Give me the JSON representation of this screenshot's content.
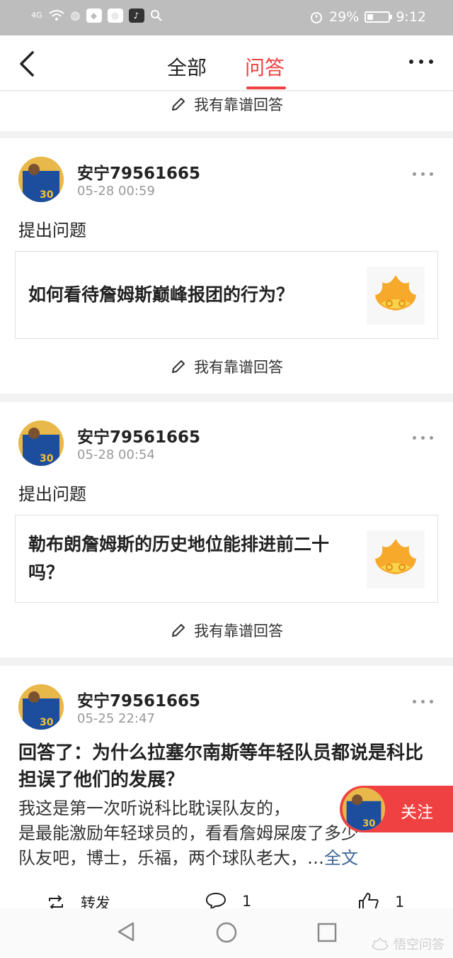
{
  "status_bar": {
    "network": "4G",
    "battery": "29%",
    "time": "9:12"
  },
  "nav": {
    "tabs": [
      {
        "label": "全部",
        "active": false
      },
      {
        "label": "问答",
        "active": true
      }
    ]
  },
  "answer_label": "我有靠谱回答",
  "posts": [
    {
      "username": "安宁79561665",
      "time": "05-28 00:59",
      "label": "提出问题",
      "question": "如何看待詹姆斯巅峰报团的行为？"
    },
    {
      "username": "安宁79561665",
      "time": "05-28 00:54",
      "label": "提出问题",
      "question": "勒布朗詹姆斯的历史地位能排进前二十吗？"
    },
    {
      "username": "安宁79561665",
      "time": "05-25 22:47",
      "headline": "回答了：为什么拉塞尔南斯等年轻队员都说是科比担误了他们的发展？",
      "body_lines": [
        "我这是第一次听说科比耽误队友的，",
        "是最能激励年轻球员的，看看詹姆屎废了多少",
        "队友吧，博士，乐福，两个球队老大，…"
      ],
      "full_text_link": "全文",
      "repost_label": "转发",
      "comment_count": "1",
      "like_count": "1"
    }
  ],
  "follow_button": "关注",
  "watermark": "悟空问答",
  "colors": {
    "accent": "#f04142",
    "link": "#406599"
  }
}
